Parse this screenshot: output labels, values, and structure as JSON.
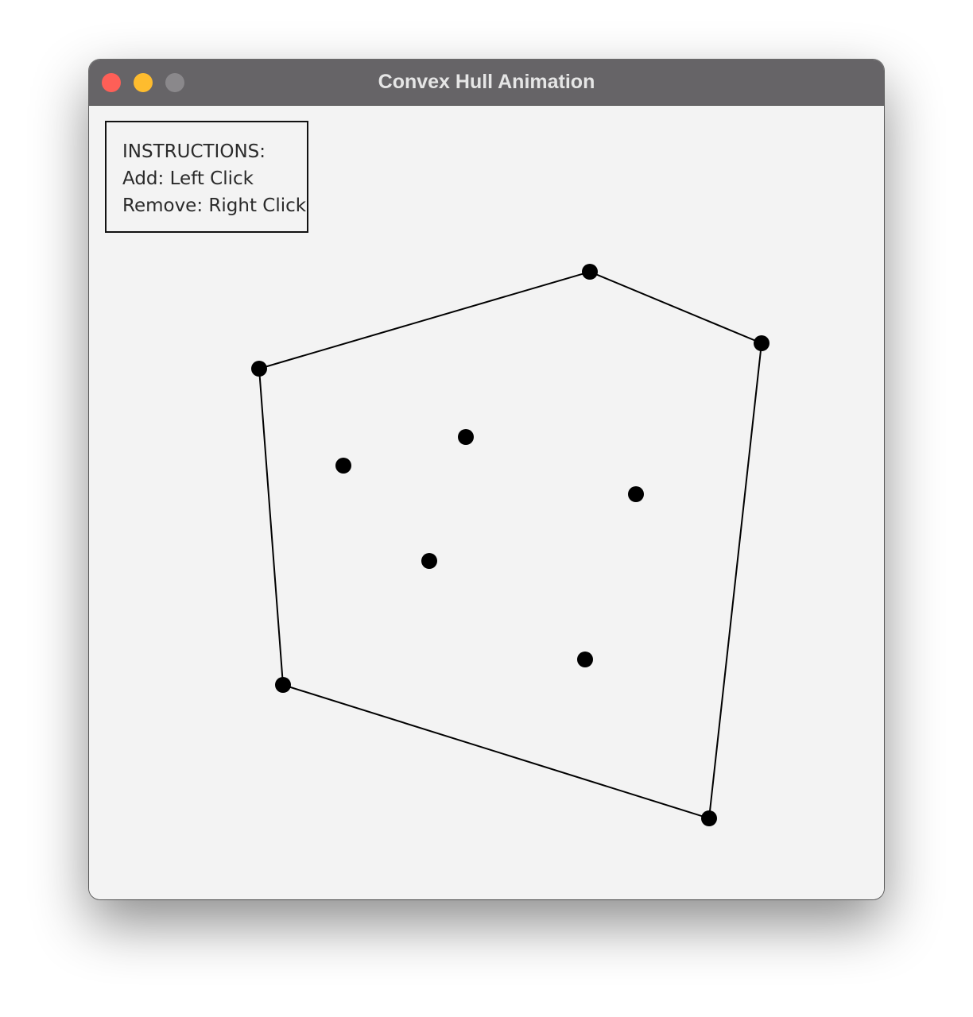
{
  "window": {
    "title": "Convex Hull Animation"
  },
  "instructions": {
    "heading": "INSTRUCTIONS:",
    "add": "Add: Left Click",
    "remove": "Remove: Right Click"
  },
  "colors": {
    "titlebar": "#666467",
    "canvas": "#f3f3f3",
    "point": "#000000",
    "hull_edge": "#000000",
    "close_button": "#fe5f57",
    "minimize_button": "#febc2e",
    "zoom_button": "#8a888b"
  },
  "icons": {
    "close": "close-icon",
    "minimize": "minimize-icon",
    "zoom": "zoom-icon"
  }
}
